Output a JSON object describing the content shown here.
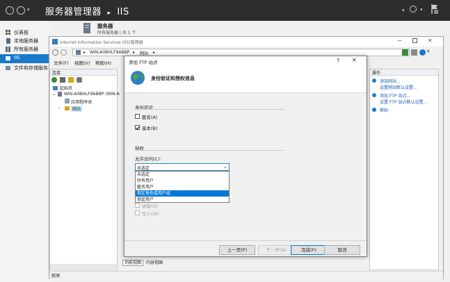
{
  "server_manager": {
    "title": "服务器管理器",
    "breadcrumb_sep": "▸",
    "section": "IIS",
    "nav": [
      {
        "label": "仪表板"
      },
      {
        "label": "本地服务器"
      },
      {
        "label": "所有服务器"
      },
      {
        "label": "IIS"
      },
      {
        "label": "文件和存储服务"
      }
    ],
    "servers_header": {
      "title": "服务器",
      "subtitle": "所有服务器 | 共 1 个"
    }
  },
  "iis_window": {
    "title": "Internet Information Services (IIS)管理器",
    "address": [
      "WIN-A0BHLF9ABBP",
      "网站"
    ],
    "menu": [
      "文件(F)",
      "视图(V)",
      "帮助(H)"
    ],
    "connections": {
      "header": "连接",
      "tree": [
        "起始页",
        "WIN-A0BHLF9ABBP (WIN-A",
        "应用程序池",
        "网站"
      ]
    },
    "actions": {
      "header": "操作",
      "items": [
        "添加网站...",
        "设置网站默认设置...",
        "添加 FTP 站点...",
        "设置 FTP 站点默认设置...",
        "帮助"
      ]
    },
    "bottom_tabs": [
      "功能视图",
      "内容视图"
    ],
    "status": "就绪"
  },
  "dialog": {
    "title": "添加 FTP 站点",
    "help_glyph": "?",
    "close_glyph": "✕",
    "heading": "身份验证和授权信息",
    "auth_group": "身份验证",
    "anonymous": {
      "label": "匿名(A)",
      "checked": false
    },
    "basic": {
      "label": "基本(B)",
      "checked": true
    },
    "authz_group": "授权",
    "allow_access_label": "允许访问(C):",
    "select_value": "未选定",
    "options": [
      "未选定",
      "所有用户",
      "匿名用户",
      "指定角色或用户组",
      "指定用户"
    ],
    "permissions": {
      "read": "读取(D)",
      "write": "写入(W)"
    },
    "buttons": {
      "prev": "上一页(P)",
      "next": "下一步(N)",
      "finish": "完成(F)",
      "cancel": "取消"
    }
  },
  "colors": {
    "accent": "#1979ca",
    "selection": "#0078d7",
    "titlebar": "#2d2d30"
  }
}
